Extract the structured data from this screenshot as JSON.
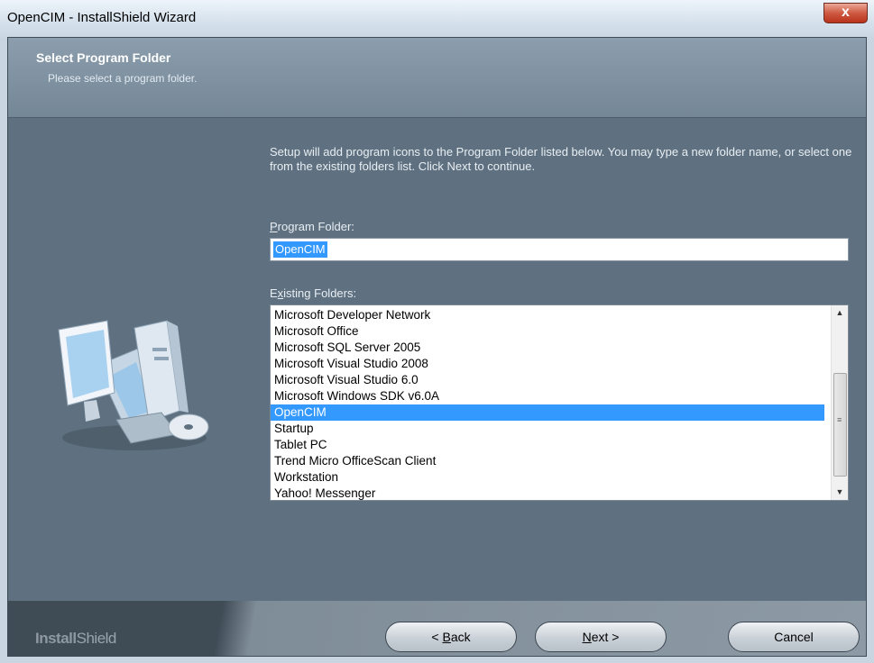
{
  "window": {
    "title": "OpenCIM - InstallShield Wizard",
    "close_symbol": "x"
  },
  "header": {
    "title": "Select Program Folder",
    "subtitle": "Please select a program folder."
  },
  "description": "Setup will add program icons to the Program Folder listed below.  You may type a new folder name, or select one from the existing folders list.  Click Next to continue.",
  "program_folder": {
    "label_accel": "P",
    "label_rest": "rogram Folder:",
    "value": "OpenCIM"
  },
  "existing_folders": {
    "label_first": "E",
    "label_accel": "x",
    "label_rest": "isting Folders:",
    "selected_index": 6,
    "items": [
      "Microsoft Developer Network",
      "Microsoft Office",
      "Microsoft SQL Server 2005",
      "Microsoft Visual Studio 2008",
      "Microsoft Visual Studio 6.0",
      "Microsoft Windows SDK v6.0A",
      "OpenCIM",
      "Startup",
      "Tablet PC",
      "Trend Micro OfficeScan Client",
      "Workstation",
      "Yahoo! Messenger"
    ]
  },
  "footer": {
    "brand_bold": "Install",
    "brand_light": "Shield",
    "back": {
      "prefix": "< ",
      "accel": "B",
      "rest": "ack"
    },
    "next": {
      "accel": "N",
      "rest": "ext >"
    },
    "cancel": "Cancel"
  },
  "colors": {
    "body_bg": "#5f7180",
    "selection": "#3399ff"
  },
  "icons": {
    "computer": "computer-icon",
    "close": "close-icon"
  }
}
